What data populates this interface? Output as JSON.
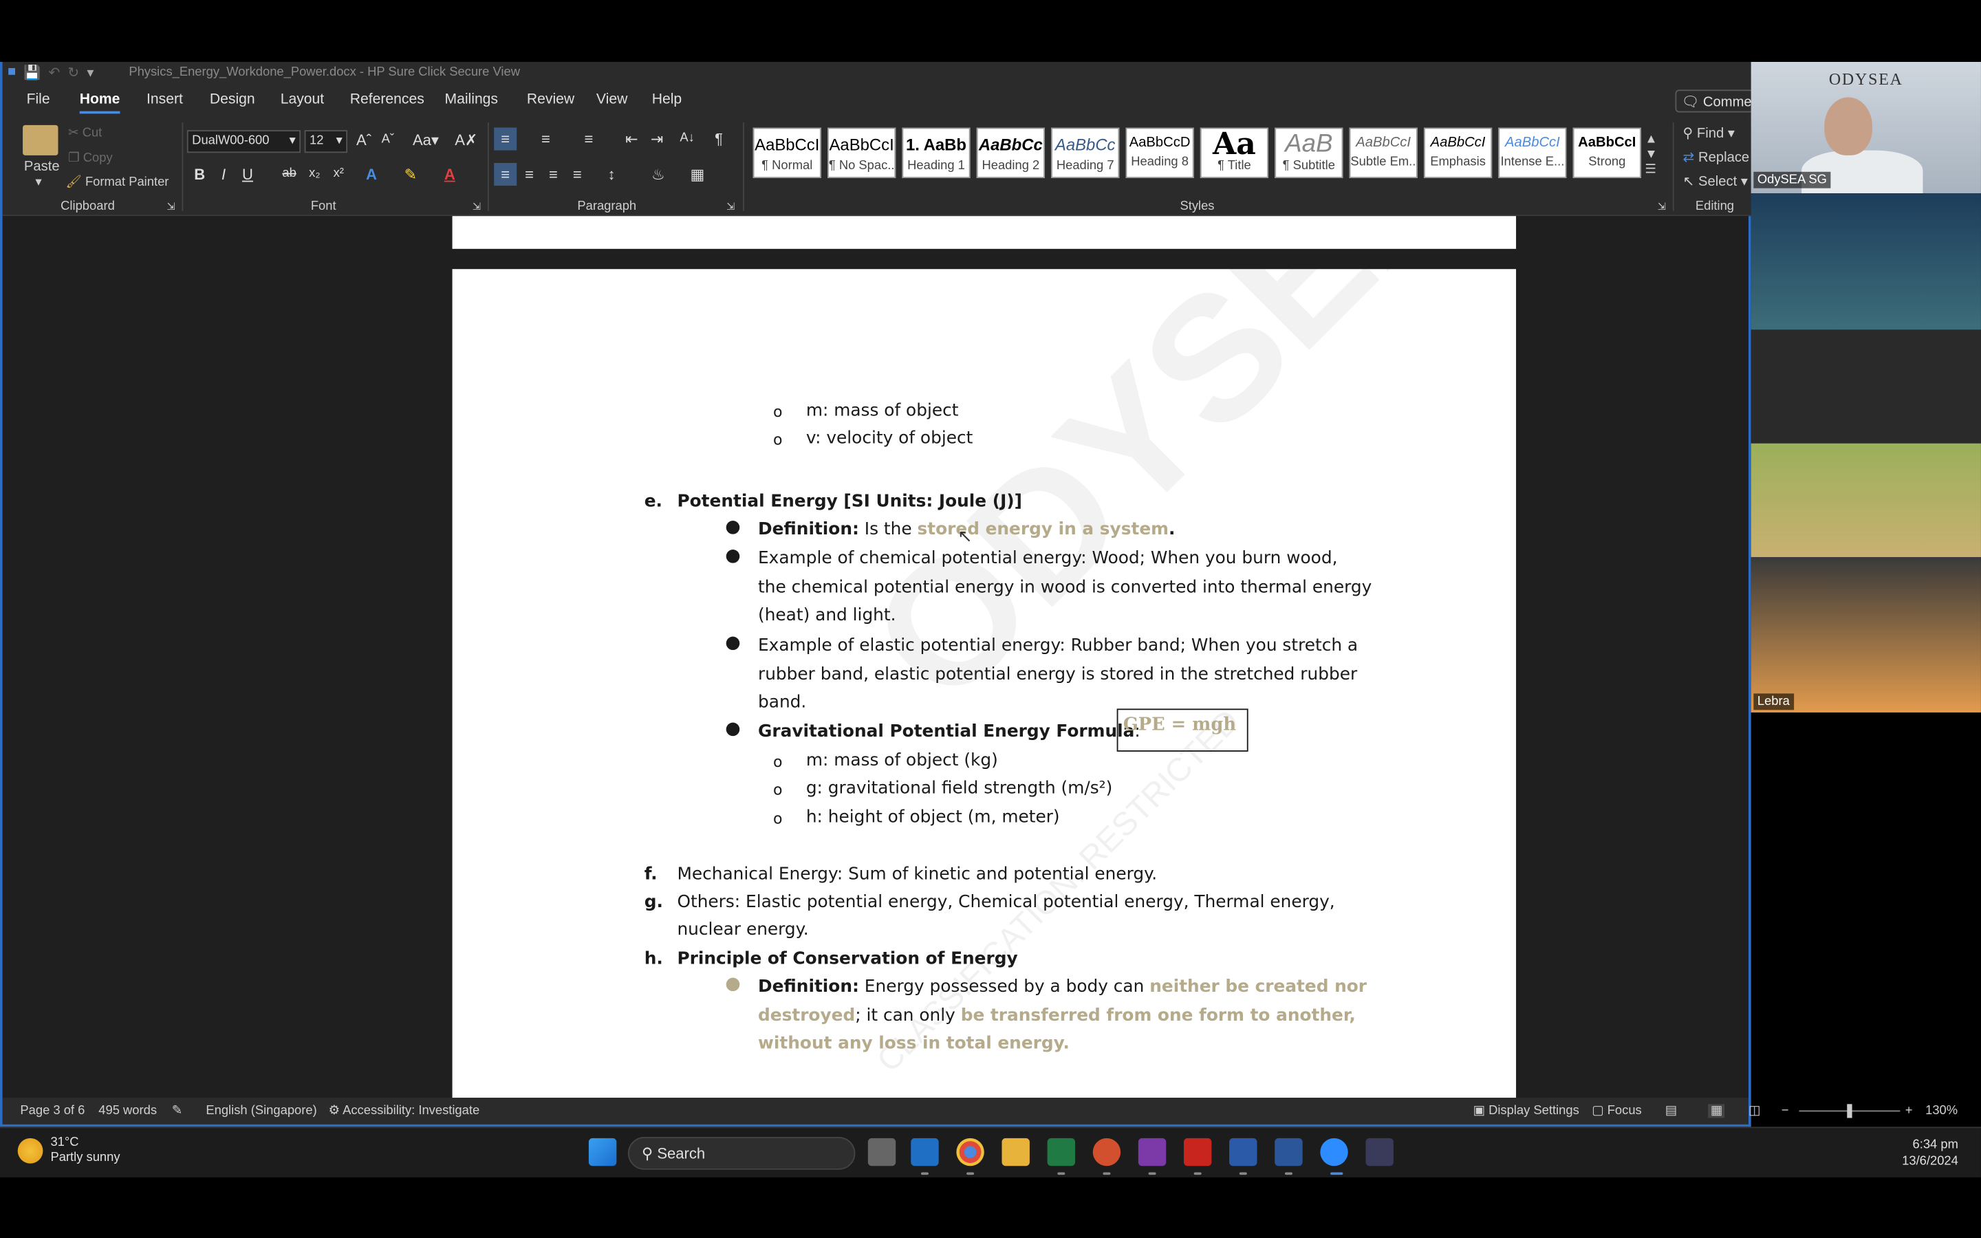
{
  "window": {
    "title": "Physics_Energy_Workdone_Power.docx - HP Sure Click Secure View"
  },
  "menu": {
    "items": [
      "File",
      "Home",
      "Insert",
      "Design",
      "Layout",
      "References",
      "Mailings",
      "Review",
      "View",
      "Help"
    ],
    "active": "Home",
    "comments": "Comments"
  },
  "ribbon": {
    "clipboard": {
      "paste": "Paste",
      "cut": "Cut",
      "copy": "Copy",
      "format_painter": "Format Painter",
      "label": "Clipboard"
    },
    "font": {
      "name": "DualW00-600",
      "size": "12",
      "label": "Font"
    },
    "paragraph": {
      "label": "Paragraph"
    },
    "styles": {
      "label": "Styles",
      "items": [
        {
          "sample": "AaBbCcI",
          "name": "¶ Normal"
        },
        {
          "sample": "AaBbCcI",
          "name": "¶ No Spac..."
        },
        {
          "sample": "1. AaBb",
          "name": "Heading 1"
        },
        {
          "sample": "AaBbCc",
          "name": "Heading 2"
        },
        {
          "sample": "AaBbCc",
          "name": "Heading 7"
        },
        {
          "sample": "AaBbCcD",
          "name": "Heading 8"
        },
        {
          "sample": "Aa",
          "name": "¶ Title"
        },
        {
          "sample": "AaB",
          "name": "¶ Subtitle"
        },
        {
          "sample": "AaBbCcI",
          "name": "Subtle Em..."
        },
        {
          "sample": "AaBbCcI",
          "name": "Emphasis"
        },
        {
          "sample": "AaBbCcI",
          "name": "Intense E..."
        },
        {
          "sample": "AaBbCcI",
          "name": "Strong"
        }
      ]
    },
    "editing": {
      "find": "Find",
      "replace": "Replace",
      "select": "Select",
      "label": "Editing"
    }
  },
  "document": {
    "lines": {
      "m_mass": "m: mass of object",
      "v_velocity": "v: velocity of object",
      "e_marker": "e.",
      "e_title": "Potential Energy [SI Units: Joule (J)]",
      "def_label": "Definition:",
      "def_text": " Is the ",
      "def_highlight": "stored energy in a system",
      "def_end": ".",
      "chem_1": "Example of chemical potential energy: Wood; When you burn wood,",
      "chem_2": "the chemical potential energy in wood is converted into thermal energy",
      "chem_3": "(heat) and light.",
      "elastic_1": "Example of elastic potential energy: Rubber band; When you stretch a",
      "elastic_2": "rubber band, elastic potential energy is stored in the stretched rubber",
      "elastic_3": "band.",
      "gpe_label": "Gravitational Potential Energy Formula",
      "gpe_colon": ":",
      "gpe_formula": "GPE = mgh",
      "gpe_m": "m: mass of object (kg)",
      "gpe_g": "g: gravitational field strength (m/s²)",
      "gpe_h": "h: height of object (m, meter)",
      "f_marker": "f.",
      "f_text": "Mechanical Energy: Sum of kinetic and potential energy.",
      "g_marker": "g.",
      "g_text_1": "Others: Elastic potential energy, Chemical potential energy, Thermal energy,",
      "g_text_2": "nuclear energy.",
      "h_marker": "h.",
      "h_title": "Principle of Conservation of Energy",
      "h_def_label": "Definition:",
      "h_def_text": " Energy possessed by a body can ",
      "h_def_hl1": "neither be created nor",
      "h_def_hl1b": "destroyed",
      "h_def_mid": "; it can only ",
      "h_def_hl2": "be transferred from one form to another,",
      "h_def_hl3": "without any loss in total energy."
    },
    "watermark": "ODYSEA",
    "watermark_sub": "CLASSIFICATION: RESTRICTED"
  },
  "status": {
    "page": "Page 3 of 6",
    "words": "495 words",
    "language": "English (Singapore)",
    "accessibility": "Accessibility: Investigate",
    "display_settings": "Display Settings",
    "focus": "Focus",
    "zoom": "130%"
  },
  "video": {
    "brand": "ODYSEA",
    "host_name": "OdySEA SG",
    "participant_name": "Lebra"
  },
  "taskbar": {
    "weather_temp": "31°C",
    "weather_desc": "Partly sunny",
    "search": "Search",
    "time": "6:34 pm",
    "date": "13/6/2024"
  },
  "colors": {
    "accent": "#2b6cc4",
    "highlight_text": "#b5ab8a"
  }
}
